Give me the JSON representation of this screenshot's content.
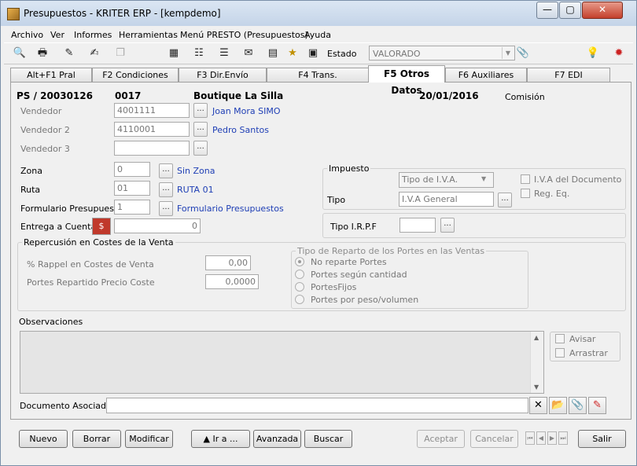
{
  "window": {
    "title": "Presupuestos - KRITER ERP - [kempdemo]",
    "minimize": "—",
    "maximize": "▢",
    "close": "✕"
  },
  "menu": [
    "Archivo",
    "Ver",
    "Informes",
    "Herramientas",
    "Menú PRESTO (Presupuestos)",
    "Ayuda"
  ],
  "toolbar": {
    "estado_label": "Estado",
    "estado_value": "VALORADO"
  },
  "tabs": [
    "Alt+F1 Pral",
    "F2 Condiciones",
    "F3 Dir.Envío",
    "F4 Trans.",
    "F5 Otros Datos",
    "F6 Auxiliares",
    "F7 EDI"
  ],
  "header": {
    "doc_id": "PS / 20030126",
    "code": "0017",
    "client": "Boutique La Silla",
    "date": "20/01/2016",
    "comision_label": "Comisión"
  },
  "vendors": {
    "vendedor_label": "Vendedor",
    "vendedor_code": "4001111",
    "vendedor_name": "Joan Mora SIMO",
    "vendedor2_label": "Vendedor 2",
    "vendedor2_code": "4110001",
    "vendedor2_name": "Pedro Santos",
    "vendedor3_label": "Vendedor 3",
    "vendedor3_code": ""
  },
  "zona": {
    "label": "Zona",
    "code": "0",
    "name": "Sin Zona"
  },
  "ruta": {
    "label": "Ruta",
    "code": "01",
    "name": "RUTA 01"
  },
  "formulario": {
    "label": "Formulario Presupuestos",
    "code": "1",
    "name": "Formulario Presupuestos"
  },
  "entrega": {
    "label": "Entrega a Cuenta",
    "value": "0"
  },
  "impuesto": {
    "group_title": "Impuesto",
    "tipo_iva": "Tipo de I.V.A.",
    "tipo_label": "Tipo",
    "tipo_value": "I.V.A General",
    "iva_documento": "I.V.A del Documento",
    "reg_eq": "Reg. Eq."
  },
  "irpf": {
    "label": "Tipo I.R.P.F",
    "value": ""
  },
  "repercusion": {
    "group_title": "Repercusión en Costes de la Venta",
    "rappel_label": "% Rappel en Costes de Venta",
    "rappel_value": "0,00",
    "portes_label": "Portes Repartido Precio Coste",
    "portes_value": "0,0000"
  },
  "reparto": {
    "group_title": "Tipo de Reparto de los Portes en las Ventas",
    "options": [
      "No reparte Portes",
      "Portes según cantidad",
      "PortesFijos",
      "Portes por peso/volumen"
    ],
    "selected": "No reparte Portes"
  },
  "observaciones": {
    "label": "Observaciones",
    "avisar": "Avisar",
    "arrastrar": "Arrastrar"
  },
  "documento": {
    "label": "Documento Asociado",
    "value": ""
  },
  "buttons": {
    "nuevo": "Nuevo",
    "borrar": "Borrar",
    "modificar": "Modificar",
    "ira": "▲ Ir a ...",
    "avanzada": "Avanzada",
    "buscar": "Buscar",
    "aceptar": "Aceptar",
    "cancelar": "Cancelar",
    "salir": "Salir"
  },
  "colors": {
    "link": "#1f3fb5",
    "titlebar": "#c4d4e8",
    "disabled_text": "#8d8d8d"
  }
}
